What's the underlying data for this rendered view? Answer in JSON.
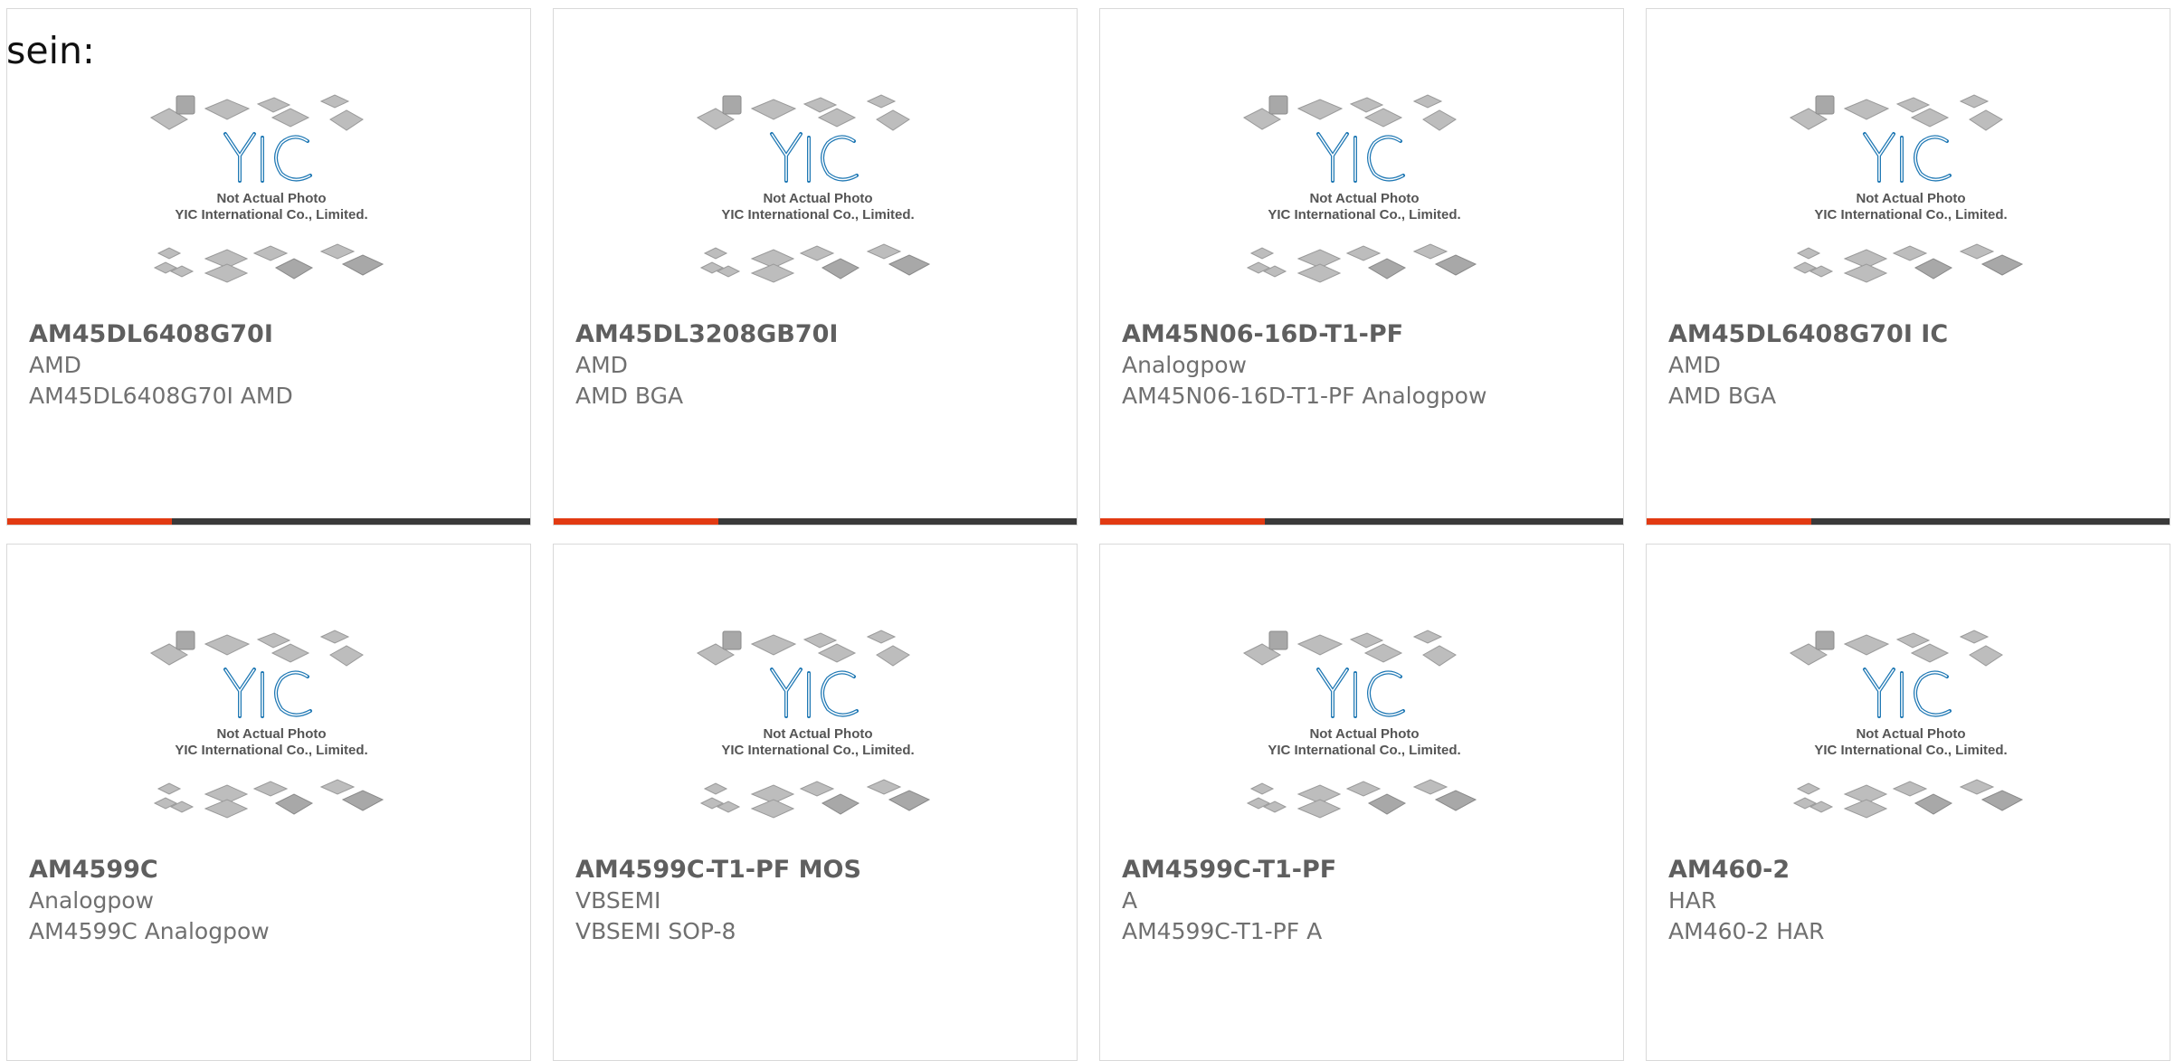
{
  "lead_text": "sein:",
  "placeholder_image": {
    "logo_text": "YIC",
    "caption_line1": "Not Actual Photo",
    "caption_line2": "YIC International Co., Limited."
  },
  "colors": {
    "accent_bar": "#e23a12",
    "bar_base": "#3a3a3a",
    "logo": "#1f78b4"
  },
  "products": [
    {
      "part_number": "AM45DL6408G70I",
      "brand": "AMD",
      "description": "AM45DL6408G70I AMD"
    },
    {
      "part_number": "AM45DL3208GB70I",
      "brand": "AMD",
      "description": "AMD BGA"
    },
    {
      "part_number": "AM45N06-16D-T1-PF",
      "brand": "Analogpow",
      "description": "AM45N06-16D-T1-PF Analogpow"
    },
    {
      "part_number": "AM45DL6408G70I IC",
      "brand": "AMD",
      "description": "AMD BGA"
    },
    {
      "part_number": "AM4599C",
      "brand": "Analogpow",
      "description": "AM4599C Analogpow"
    },
    {
      "part_number": "AM4599C-T1-PF MOS",
      "brand": "VBSEMI",
      "description": "VBSEMI SOP-8"
    },
    {
      "part_number": "AM4599C-T1-PF",
      "brand": "A",
      "description": "AM4599C-T1-PF A"
    },
    {
      "part_number": "AM460-2",
      "brand": "HAR",
      "description": "AM460-2 HAR"
    }
  ]
}
